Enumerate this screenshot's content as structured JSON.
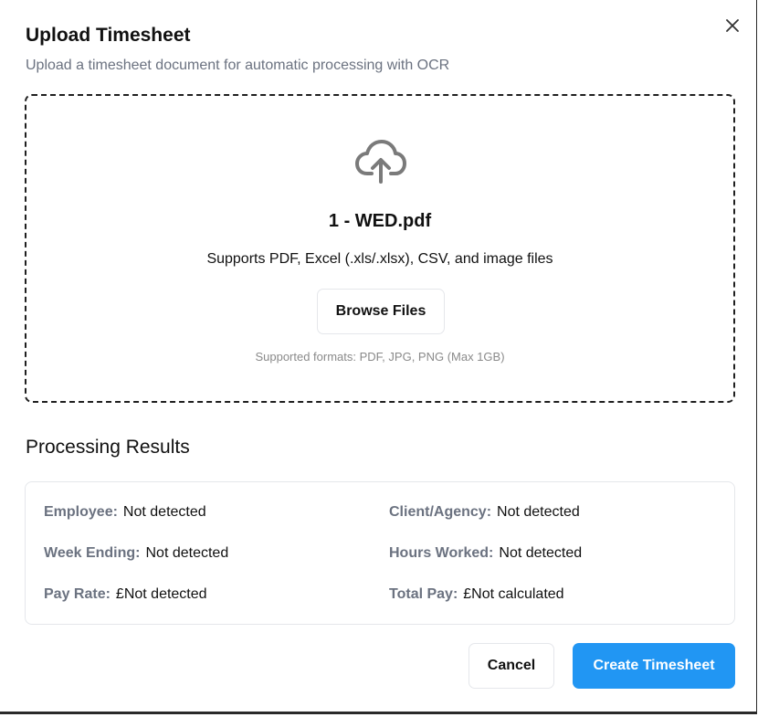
{
  "dialog": {
    "title": "Upload Timesheet",
    "subtitle": "Upload a timesheet document for automatic processing with OCR",
    "close_icon": "close-icon"
  },
  "dropzone": {
    "icon": "cloud-upload-icon",
    "filename": "1 - WED.pdf",
    "supports_text": "Supports PDF, Excel (.xls/.xlsx), CSV, and image files",
    "browse_label": "Browse Files",
    "formats_text": "Supported formats: PDF, JPG, PNG (Max 1GB)"
  },
  "results": {
    "heading": "Processing Results",
    "fields": [
      {
        "label": "Employee:",
        "value": "Not detected"
      },
      {
        "label": "Client/Agency:",
        "value": "Not detected"
      },
      {
        "label": "Week Ending:",
        "value": "Not detected"
      },
      {
        "label": "Hours Worked:",
        "value": "Not detected"
      },
      {
        "label": "Pay Rate:",
        "value": "£Not detected"
      },
      {
        "label": "Total Pay:",
        "value": "£Not calculated"
      }
    ]
  },
  "footer": {
    "cancel_label": "Cancel",
    "create_label": "Create Timesheet"
  },
  "colors": {
    "primary": "#2196f3",
    "muted_text": "#6b7280",
    "border": "#e5e7eb"
  }
}
